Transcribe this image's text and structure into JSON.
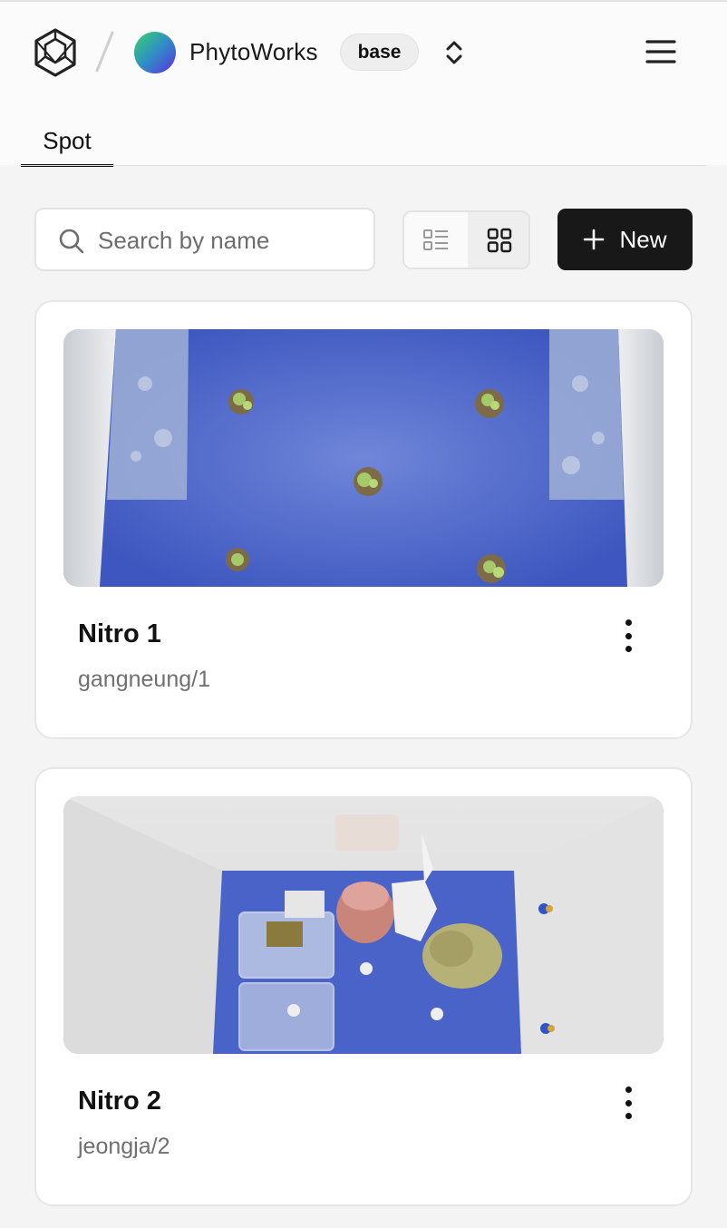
{
  "header": {
    "org_name": "PhytoWorks",
    "env_badge": "base",
    "logo_icon": "hexagon-cube-logo",
    "switcher_icon": "chevron-up-down-icon",
    "menu_icon": "hamburger-menu-icon"
  },
  "tabs": [
    {
      "label": "Spot",
      "active": true
    }
  ],
  "toolbar": {
    "search_placeholder": "Search by name",
    "search_value": "",
    "view_mode": "grid",
    "new_label": "New"
  },
  "cards": [
    {
      "title": "Nitro 1",
      "subtitle": "gangneung/1",
      "image": "top-down photo of blue tray with five small seedlings"
    },
    {
      "title": "Nitro 2",
      "subtitle": "jeongja/2",
      "image": "top-down photo of chamber with blue floor, containers and a wilted plant"
    }
  ],
  "colors": {
    "primary_button": "#181818",
    "tray_blue": "#4a63c8",
    "text_muted": "#707070"
  }
}
